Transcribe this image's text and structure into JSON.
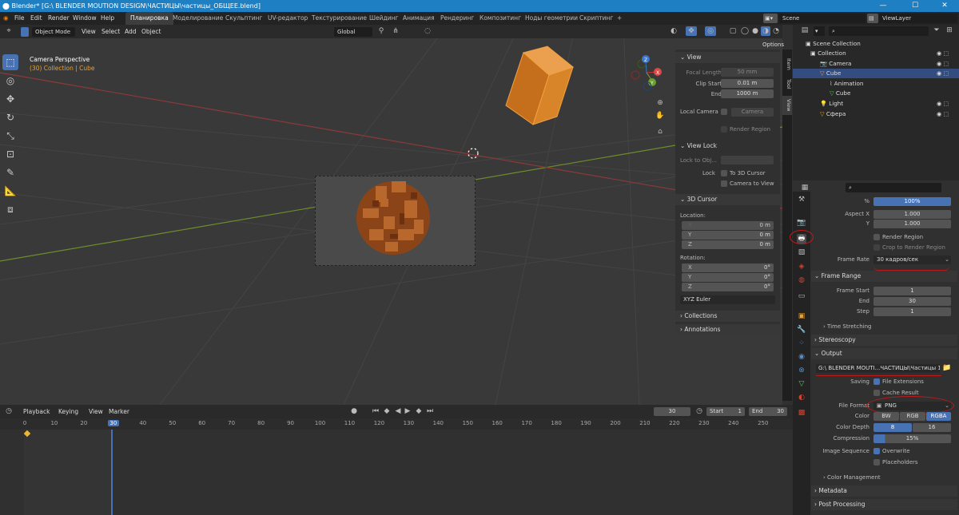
{
  "title": "Blender* [G:\\ BLENDER MOUTION DESIGN\\ЧАСТИЦЫ\\частицы_ОБЩЕЕ.blend]",
  "window_controls": {
    "minimize": "—",
    "maximize": "☐",
    "close": "✕"
  },
  "menu": [
    "File",
    "Edit",
    "Render",
    "Window",
    "Help"
  ],
  "workspaces": [
    "Планировка",
    "Моделирование",
    "Скульптинг",
    "UV-редактор",
    "Текстурирование",
    "Шейдинг",
    "Анимация",
    "Рендеринг",
    "Композитинг",
    "Ноды геометрии",
    "Скриптинг",
    "+"
  ],
  "scene": {
    "name": "Scene",
    "view_layer": "ViewLayer"
  },
  "viewport_header": {
    "mode": "Object Mode",
    "items": [
      "View",
      "Select",
      "Add",
      "Object"
    ],
    "transform": "Global",
    "options": "Options"
  },
  "viewport_info": {
    "line1": "Camera Perspective",
    "line2": "(30) Collection | Cube"
  },
  "gizmo_labels": {
    "x": "X",
    "y": "Y",
    "z": "Z"
  },
  "npanel": {
    "tabs": [
      "Item",
      "Tool",
      "View"
    ],
    "view_header": "View",
    "focal_length_label": "Focal Length",
    "focal_length": "50 mm",
    "clip_start_label": "Clip Start",
    "clip_start": "0.01 m",
    "end_label": "End",
    "end": "1000 m",
    "local_camera_label": "Local Camera",
    "local_camera": "Camera",
    "render_region": "Render Region",
    "view_lock_header": "View Lock",
    "lock_to_object": "Lock to Obj...",
    "lock_label": "Lock",
    "to_3d_cursor": "To 3D Cursor",
    "camera_to_view": "Camera to View",
    "cursor_header": "3D Cursor",
    "location_label": "Location:",
    "rotation_label": "Rotation:",
    "loc": [
      {
        "axis": "X",
        "value": "0 m"
      },
      {
        "axis": "Y",
        "value": "0 m"
      },
      {
        "axis": "Z",
        "value": "0 m"
      }
    ],
    "rot": [
      {
        "axis": "X",
        "value": "0°"
      },
      {
        "axis": "Y",
        "value": "0°"
      },
      {
        "axis": "Z",
        "value": "0°"
      }
    ],
    "rot_mode": "XYZ Euler",
    "collections": "Collections",
    "annotations": "Annotations"
  },
  "timeline": {
    "menus": [
      "Playback",
      "Keying",
      "View",
      "Marker"
    ],
    "current_frame": "30",
    "start_label": "Start",
    "start": "1",
    "end_label": "End",
    "end": "30",
    "ticks": [
      "0",
      "10",
      "20",
      "30",
      "40",
      "50",
      "60",
      "70",
      "80",
      "90",
      "100",
      "110",
      "120",
      "130",
      "140",
      "150",
      "160",
      "170",
      "180",
      "190",
      "200",
      "210",
      "220",
      "230",
      "240",
      "250"
    ]
  },
  "outliner": {
    "root": "Scene Collection",
    "rows": [
      {
        "name": "Collection",
        "indent": 0
      },
      {
        "name": "Camera",
        "indent": 1
      },
      {
        "name": "Cube",
        "indent": 1
      },
      {
        "name": "Animation",
        "indent": 2
      },
      {
        "name": "Cube",
        "indent": 2
      },
      {
        "name": "Light",
        "indent": 1
      },
      {
        "name": "Сфера",
        "indent": 1
      }
    ]
  },
  "props": {
    "percent_label": "%",
    "percent": "100%",
    "aspect_x_label": "Aspect X",
    "aspect_x": "1.000",
    "aspect_y_label": "Y",
    "aspect_y": "1.000",
    "render_region": "Render Region",
    "crop_region": "Crop to Render Region",
    "frame_rate_label": "Frame Rate",
    "frame_rate": "30 кадров/сек",
    "frame_range_header": "Frame Range",
    "frame_start_label": "Frame Start",
    "frame_start": "1",
    "end_label": "End",
    "end": "30",
    "step_label": "Step",
    "step": "1",
    "time_stretching": "Time Stretching",
    "stereoscopy": "Stereoscopy",
    "output_header": "Output",
    "output_path": "G:\\ BLENDER MOUTI...ЧАСТИЦЫ\\Частицы 1\\",
    "saving_label": "Saving",
    "file_extensions": "File Extensions",
    "cache_result": "Cache Result",
    "file_format_label": "File Format",
    "file_format": "PNG",
    "color_label": "Color",
    "color_options": [
      "BW",
      "RGB",
      "RGBA"
    ],
    "color_depth_label": "Color Depth",
    "depth_options": [
      "8",
      "16"
    ],
    "compression_label": "Compression",
    "compression": "15%",
    "image_seq_label": "Image Sequence",
    "overwrite": "Overwrite",
    "placeholders": "Placeholders",
    "color_management": "Color Management",
    "metadata": "Metadata",
    "post_processing": "Post Processing"
  },
  "colors": {
    "accent": "#4772b3",
    "title_blue": "#1e7fc2",
    "object_orange": "#e08a2c",
    "annotation_red": "#c01818"
  }
}
